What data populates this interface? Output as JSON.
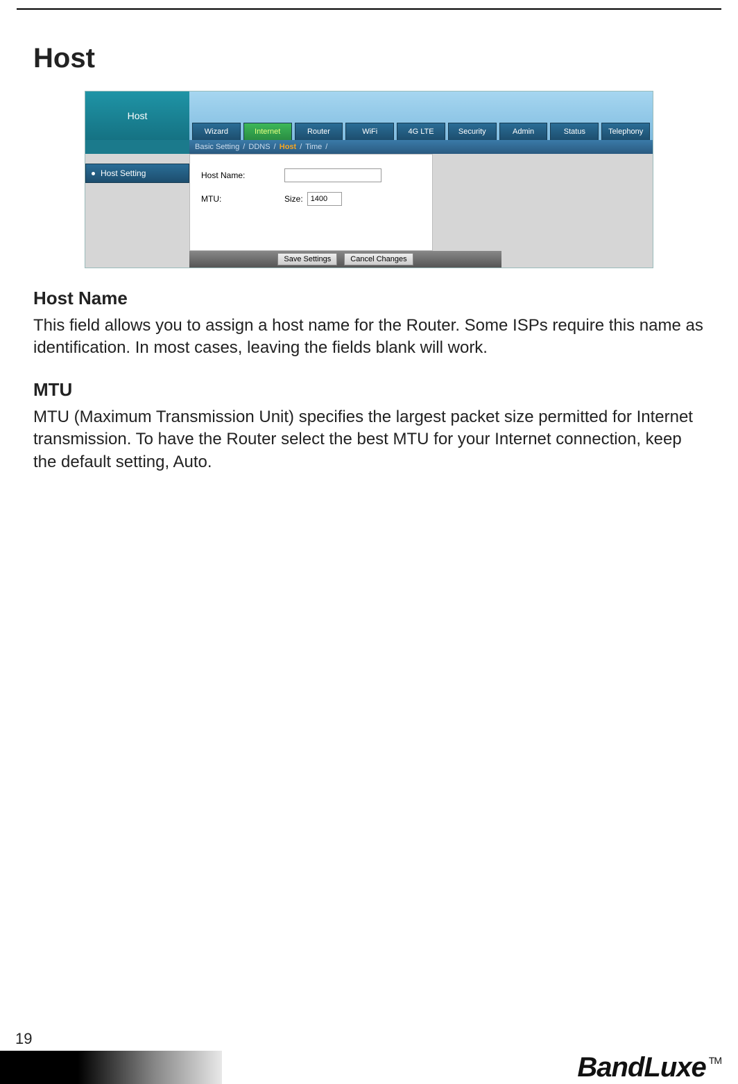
{
  "page_number": "19",
  "brand": "BandLuxe",
  "trademark": "TM",
  "title": "Host",
  "screenshot": {
    "header_left": "Host",
    "tabs": [
      "Wizard",
      "Internet",
      "Router",
      "WiFi",
      "4G LTE",
      "Security",
      "Admin",
      "Status",
      "Telephony"
    ],
    "active_tab_index": 1,
    "subnav": {
      "items": [
        "Basic Setting",
        "DDNS",
        "Host",
        "Time"
      ],
      "active_index": 2,
      "separator": "/"
    },
    "sidebar_item": "Host Setting",
    "form": {
      "hostname_label": "Host Name:",
      "hostname_value": "",
      "mtu_label": "MTU:",
      "mtu_size_label": "Size:",
      "mtu_value": "1400"
    },
    "buttons": {
      "save": "Save Settings",
      "cancel": "Cancel Changes"
    }
  },
  "sections": {
    "hostname_heading": "Host Name",
    "hostname_body": "This field allows you to assign a host name for the Router. Some ISPs require this name as identification. In most cases, leaving the fields blank will work.",
    "mtu_heading": "MTU",
    "mtu_body": "MTU (Maximum Transmission Unit) specifies the largest packet size permitted for Internet transmission. To have the Router select the best MTU for your Internet connection, keep the default setting, Auto."
  }
}
